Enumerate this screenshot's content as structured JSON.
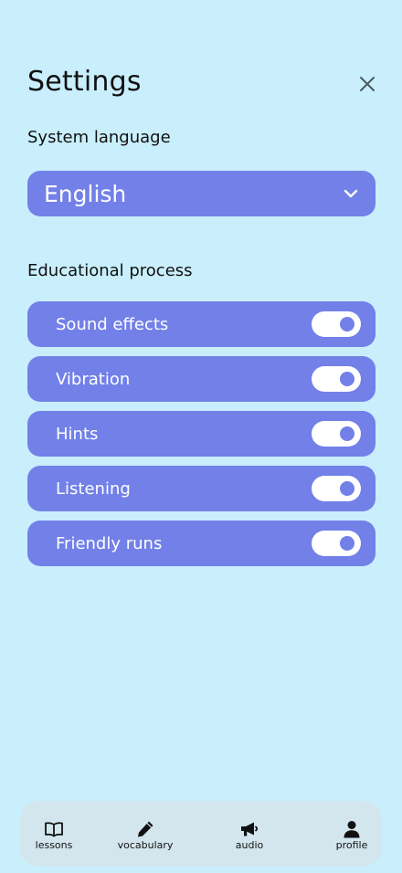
{
  "header": {
    "title": "Settings",
    "close_icon": "close-icon"
  },
  "language": {
    "label": "System language",
    "value": "English",
    "icon": "chevron-down-icon"
  },
  "education": {
    "label": "Educational process",
    "items": [
      {
        "label": "Sound effects",
        "enabled": true
      },
      {
        "label": "Vibration",
        "enabled": true
      },
      {
        "label": "Hints",
        "enabled": true
      },
      {
        "label": "Listening",
        "enabled": true
      },
      {
        "label": "Friendly runs",
        "enabled": true
      }
    ]
  },
  "nav": {
    "items": [
      {
        "label": "lessons",
        "icon": "book-icon"
      },
      {
        "label": "vocabulary",
        "icon": "pencil-icon"
      },
      {
        "label": "audio",
        "icon": "megaphone-icon"
      },
      {
        "label": "profile",
        "icon": "person-icon"
      }
    ]
  },
  "colors": {
    "background": "#c9eefc",
    "accent": "#7280e8",
    "nav_background": "#d3e6ee"
  }
}
